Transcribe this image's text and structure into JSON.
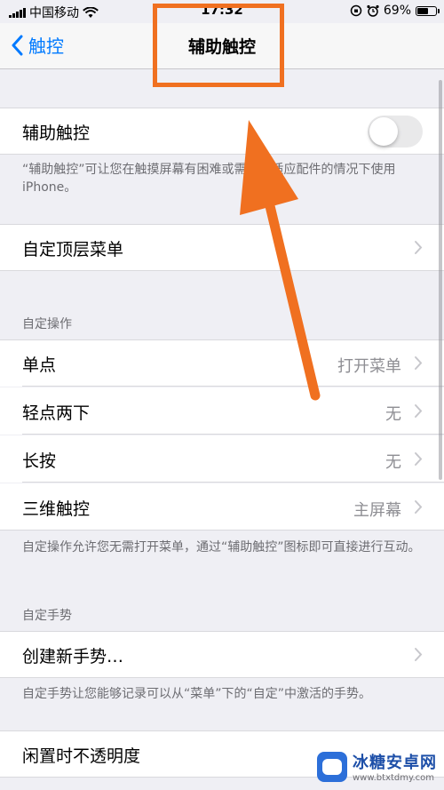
{
  "status_bar": {
    "carrier": "中国移动",
    "time": "17:32",
    "battery_percent": "69%",
    "battery_level": 0.69,
    "icons": [
      "signal-icon",
      "wifi-icon",
      "orientation-lock-icon",
      "alarm-icon",
      "battery-icon"
    ]
  },
  "nav": {
    "back_label": "触控",
    "title": "辅助触控"
  },
  "assistive_touch": {
    "label": "辅助触控",
    "enabled": false,
    "footer": "“辅助触控”可让您在触摸屏幕有困难或需要自适应配件的情况下使用 iPhone。"
  },
  "top_menu": {
    "label": "自定顶层菜单"
  },
  "custom_actions": {
    "header": "自定操作",
    "items": [
      {
        "label": "单点",
        "value": "打开菜单"
      },
      {
        "label": "轻点两下",
        "value": "无"
      },
      {
        "label": "长按",
        "value": "无"
      },
      {
        "label": "三维触控",
        "value": "主屏幕"
      }
    ],
    "footer": "自定操作允许您无需打开菜单，通过“辅助触控”图标即可直接进行互动。"
  },
  "custom_gestures": {
    "header": "自定手势",
    "create_label": "创建新手势…",
    "footer": "自定手势让您能够记录可以从“菜单”下的“自定”中激活的手势。"
  },
  "idle_opacity": {
    "label": "闲置时不透明度"
  },
  "watermark": {
    "title": "冰糖安卓网",
    "url": "www.btxtdmy.com"
  },
  "colors": {
    "accent": "#007aff",
    "annotation": "#f07020",
    "background": "#efeff4"
  }
}
